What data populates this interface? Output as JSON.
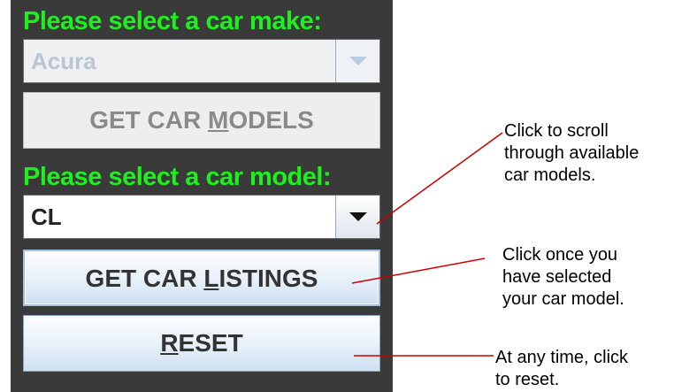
{
  "form": {
    "make_heading": "Please select a car make:",
    "make_select": {
      "value": "Acura",
      "enabled": false
    },
    "get_models_button": {
      "label_pre": "GET CAR ",
      "label_mnemonic": "M",
      "label_post": "ODELS",
      "enabled": false
    },
    "model_heading": "Please select a car model:",
    "model_select": {
      "value": "CL",
      "enabled": true
    },
    "get_listings_button": {
      "label_pre": "GET CAR ",
      "label_mnemonic": "L",
      "label_post": "ISTINGS",
      "enabled": true
    },
    "reset_button": {
      "label_pre": "",
      "label_mnemonic": "R",
      "label_post": "ESET",
      "enabled": true
    }
  },
  "annotations": {
    "scroll_note": "Click to scroll\nthrough available\ncar models.",
    "listings_note": "Click once you\nhave selected\nyour car model.",
    "reset_note": "At any time, click\nto reset."
  },
  "colors": {
    "panel_background": "#3a3a3a",
    "heading_text": "#1fef1f",
    "callout_line": "#cc0000"
  },
  "icons": {
    "dropdown_arrow": "chevron-down-icon"
  }
}
